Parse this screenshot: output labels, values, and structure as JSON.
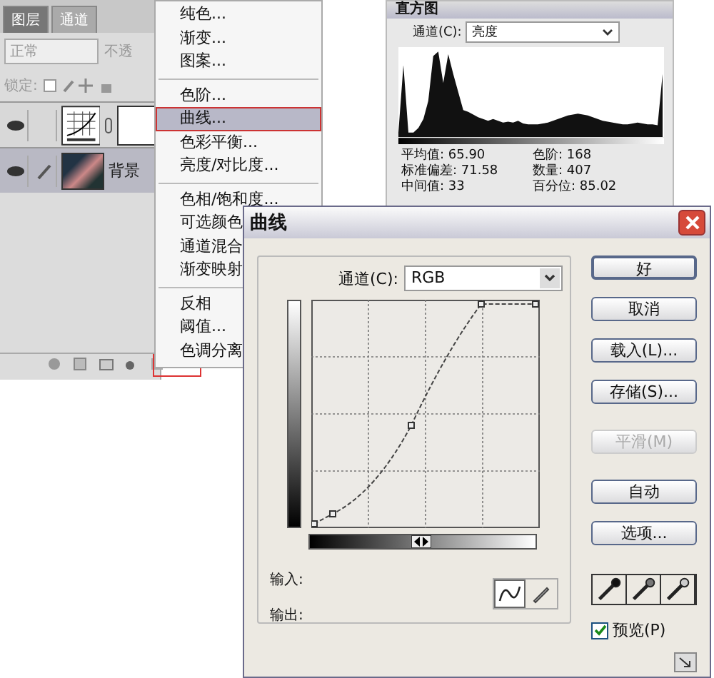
{
  "layers_panel": {
    "tabs": [
      {
        "label": "图层",
        "selected": true
      },
      {
        "label": "通道",
        "selected": false
      }
    ],
    "blend_mode": "正常",
    "opacity_label": "不透",
    "lock_label": "锁定:",
    "layers": [
      {
        "kind": "adjustment",
        "visible": true,
        "selected": false
      },
      {
        "kind": "image",
        "name": "背景",
        "visible": true,
        "selected": true
      }
    ]
  },
  "menu": {
    "sections": [
      [
        {
          "label": "纯色...",
          "selected": false
        },
        {
          "label": "渐变...",
          "selected": false
        },
        {
          "label": "图案...",
          "selected": false
        }
      ],
      [
        {
          "label": "色阶...",
          "selected": false
        },
        {
          "label": "曲线...",
          "selected": true
        },
        {
          "label": "色彩平衡...",
          "selected": false
        },
        {
          "label": "亮度/对比度...",
          "selected": false
        }
      ],
      [
        {
          "label": "色相/饱和度...",
          "selected": false
        },
        {
          "label": "可选颜色",
          "selected": false
        },
        {
          "label": "通道混合",
          "selected": false
        },
        {
          "label": "渐变映射",
          "selected": false
        }
      ],
      [
        {
          "label": "反相",
          "selected": false
        },
        {
          "label": "阈值...",
          "selected": false
        },
        {
          "label": "色调分离",
          "selected": false
        }
      ]
    ]
  },
  "histogram": {
    "title": "直方图",
    "channel_label": "通道(C):",
    "channel": "亮度",
    "stats": [
      {
        "label": "平均值:",
        "value": "65.90"
      },
      {
        "label": "色阶:",
        "value": "168"
      },
      {
        "label": "标准偏差:",
        "value": "71.58"
      },
      {
        "label": "数量:",
        "value": "407"
      },
      {
        "label": "中间值:",
        "value": "33"
      },
      {
        "label": "百分位:",
        "value": "85.02"
      }
    ]
  },
  "curves": {
    "title": "曲线",
    "channel_label": "通道(C):",
    "channel": "RGB",
    "input_label": "输入:",
    "output_label": "输出:",
    "buttons": [
      {
        "label": "好",
        "default": true,
        "disabled": false
      },
      {
        "label": "取消",
        "default": false,
        "disabled": false
      },
      {
        "label": "载入(L)...",
        "default": false,
        "disabled": false
      },
      {
        "label": "存储(S)...",
        "default": false,
        "disabled": false
      },
      {
        "label": "平滑(M)",
        "default": false,
        "disabled": true
      },
      {
        "label": "自动",
        "default": false,
        "disabled": false
      },
      {
        "label": "选项...",
        "default": false,
        "disabled": false
      }
    ],
    "tools": [
      {
        "kind": "curve",
        "selected": true
      },
      {
        "kind": "pencil",
        "selected": false
      }
    ],
    "preview": {
      "label": "预览(P)",
      "checked": true
    }
  }
}
